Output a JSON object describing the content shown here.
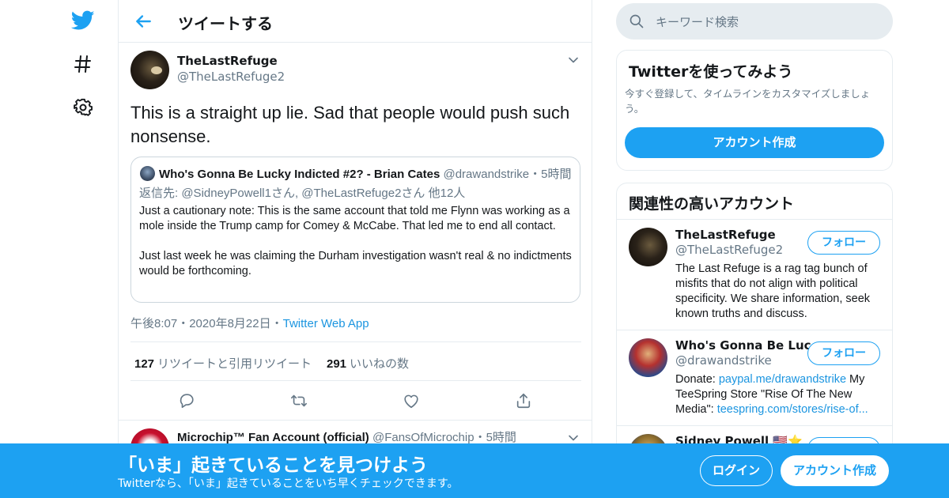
{
  "header": {
    "title": "ツイートする"
  },
  "tweet": {
    "author_name": "TheLastRefuge",
    "author_handle": "@TheLastRefuge2",
    "text": "This is a straight up lie.  Sad that people would push such nonsense.",
    "quote": {
      "name": "Who's Gonna Be Lucky Indicted #2? - Brian Cates",
      "handle": "@drawandstrike",
      "separator": "・",
      "time": "5時間",
      "reply_to": "返信先: @SidneyPowell1さん, @TheLastRefuge2さん 他12人",
      "body": "Just a cautionary  note: This is the same account that told me Flynn was working as a mole inside the Trump camp for Comey & McCabe. That led me to end all contact.\n\nJust last week he was claiming the Durham investigation wasn't real & no indictments would be forthcoming."
    },
    "meta": {
      "time": "午後8:07",
      "date": "2020年8月22日",
      "sep": "・",
      "source": "Twitter Web App"
    },
    "stats": {
      "retweets_count": "127",
      "retweets_label": "リツイートと引用リツイート",
      "likes_count": "291",
      "likes_label": "いいねの数"
    }
  },
  "next_tweet": {
    "name": "Microchip™ Fan Account (official)",
    "handle": "@FansOfMicrochip",
    "separator": "・",
    "time": "5時間"
  },
  "search": {
    "placeholder": "キーワード検索"
  },
  "signup_card": {
    "title": "Twitterを使ってみよう",
    "subtitle": "今すぐ登録して、タイムラインをカスタマイズしましょう。",
    "button": "アカウント作成"
  },
  "related": {
    "title": "関連性の高いアカウント",
    "accounts": [
      {
        "name": "TheLastRefuge",
        "handle": "@TheLastRefuge2",
        "follow": "フォロー",
        "bio": "The Last Refuge is a rag tag bunch of misfits that do not align with political specificity. We share information, seek known truths and discuss."
      },
      {
        "name": "Who's Gonna Be Luc...",
        "handle": "@drawandstrike",
        "follow": "フォロー",
        "bio_prefix": "Donate: ",
        "bio_link1": "paypal.me/drawandstrike",
        "bio_mid": " My TeeSpring Store \"Rise Of The New Media\": ",
        "bio_link2": "teespring.com/stores/rise-of..."
      },
      {
        "name": "Sidney Powell 🇺🇸⭐",
        "follow": "フォロー"
      }
    ]
  },
  "banner": {
    "title": "「いま」起きていることを見つけよう",
    "subtitle": "Twitterなら、「いま」起きていることをいち早くチェックできます。",
    "login": "ログイン",
    "signup": "アカウント作成"
  },
  "colors": {
    "accent": "#1da1f2",
    "link": "#1b95e0",
    "muted": "#657786",
    "border": "#e6ecf0"
  }
}
